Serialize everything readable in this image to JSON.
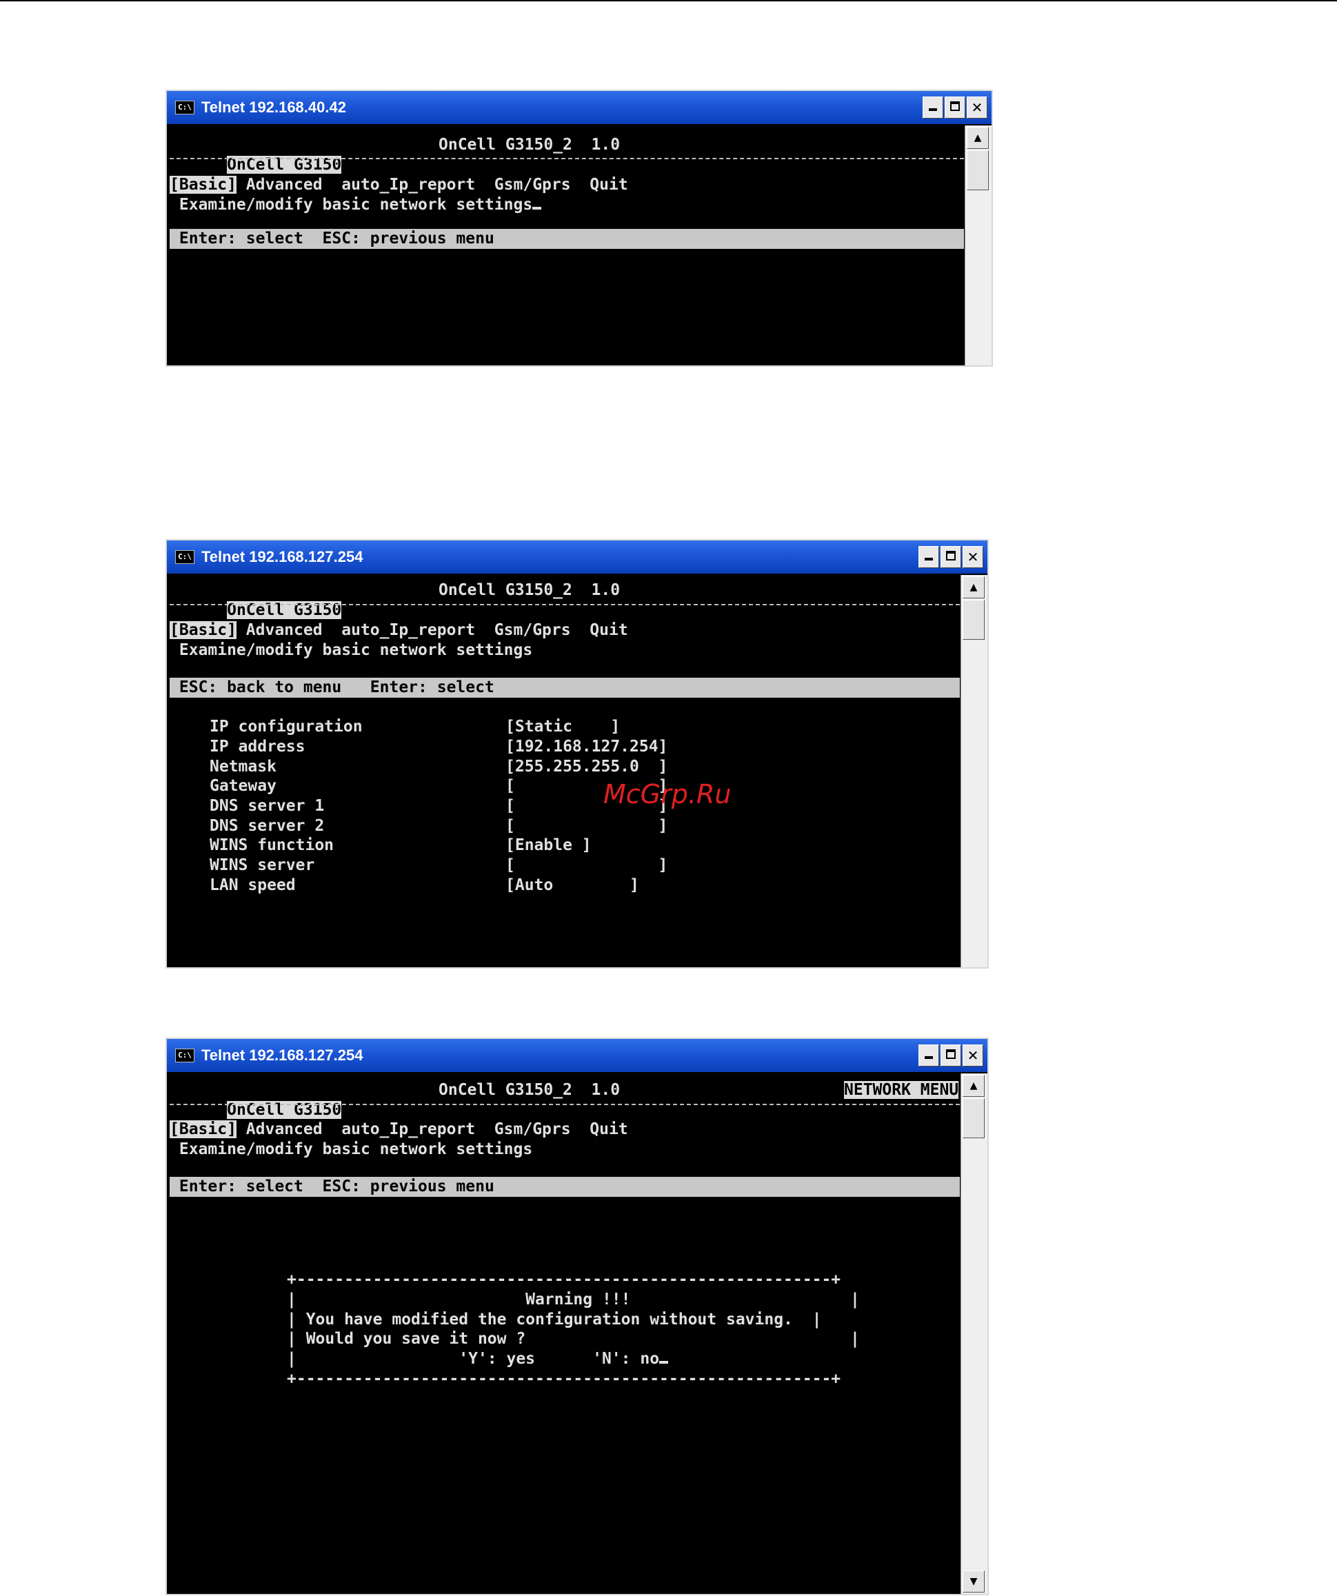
{
  "window1": {
    "title": "Telnet 192.168.40.42",
    "header_left": "OnCell G3150",
    "header_center": "OnCell G3150_2  1.0",
    "menu": {
      "selected": "[Basic]",
      "rest": " Advanced  auto_Ip_report  Gsm/Gprs  Quit"
    },
    "description": " Examine/modify basic network settings",
    "status": " Enter: select  ESC: previous menu"
  },
  "window2": {
    "title": "Telnet 192.168.127.254",
    "header_left": "OnCell G3150",
    "header_center": "OnCell G3150_2  1.0",
    "menu": {
      "selected": "[Basic]",
      "rest": " Advanced  auto_Ip_report  Gsm/Gprs  Quit"
    },
    "description": " Examine/modify basic network settings",
    "status": " ESC: back to menu   Enter: select",
    "settings": [
      {
        "label": "IP configuration",
        "value": "[Static    ]"
      },
      {
        "label": "IP address",
        "value": "[192.168.127.254]"
      },
      {
        "label": "Netmask",
        "value": "[255.255.255.0  ]"
      },
      {
        "label": "Gateway",
        "value": "[               ]"
      },
      {
        "label": "DNS server 1",
        "value": "[               ]"
      },
      {
        "label": "DNS server 2",
        "value": "[               ]"
      },
      {
        "label": "WINS function",
        "value": "[Enable ]"
      },
      {
        "label": "WINS server",
        "value": "[               ]"
      },
      {
        "label": "LAN speed",
        "value": "[Auto        ]"
      }
    ]
  },
  "window3": {
    "title": "Telnet 192.168.127.254",
    "header_left": "OnCell G3150",
    "header_center": "OnCell G3150_2  1.0",
    "header_right": "NETWORK MENU",
    "menu": {
      "selected": "[Basic]",
      "rest": " Advanced  auto_Ip_report  Gsm/Gprs  Quit"
    },
    "description": " Examine/modify basic network settings",
    "status": " Enter: select  ESC: previous menu",
    "dialog": {
      "border": "+--------------------------------------------------------+",
      "title": "|                        Warning !!!                       |",
      "line1": "| You have modified the configuration without saving.  |",
      "line2": "| Would you save it now ?                                  |",
      "prompt": "|                 'Y': yes      'N': no"
    }
  },
  "watermark": "McGrp.Ru"
}
